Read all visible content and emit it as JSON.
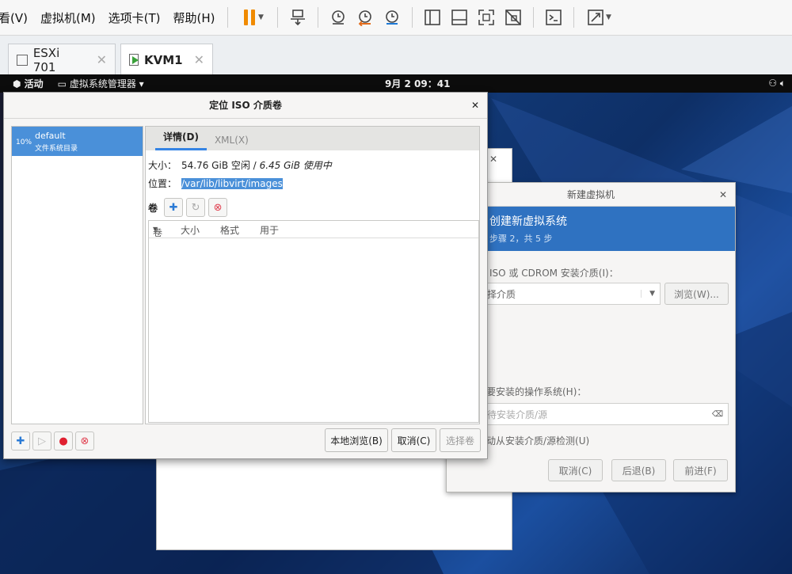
{
  "menubar": {
    "items": [
      "看(V)",
      "虚拟机(M)",
      "选项卡(T)",
      "帮助(H)"
    ]
  },
  "tabs": [
    {
      "label": "ESXi 701",
      "active": false
    },
    {
      "label": "KVM1",
      "active": true
    }
  ],
  "gnome": {
    "activities": "活动",
    "app": "虚拟系统管理器",
    "clock": "9月 2 09：41"
  },
  "new_vm": {
    "title": "新建虚拟机",
    "heading": "创建新虚拟系统",
    "step": "步骤 2，共 5 步",
    "iso_label": "ISO 或 CDROM 安装介质(I)：",
    "iso_value": "择介质",
    "browse": "浏览(W)...",
    "os_label": "要安装的操作系统(H)：",
    "os_placeholder": "待安装介质/源",
    "auto_detect": "动从安装介质/源检测(U)",
    "cancel": "取消(C)",
    "back": "后退(B)",
    "forward": "前进(F)"
  },
  "dialog": {
    "title": "定位 ISO 介质卷",
    "pool": {
      "percent": "10%",
      "name": "default",
      "type": "文件系统目录"
    },
    "tabs": [
      {
        "label": "详情(D)",
        "active": true
      },
      {
        "label": "XML(X)",
        "active": false
      }
    ],
    "size_label": "大小：",
    "size_free": "54.76 GiB 空闲 /",
    "size_used": "6.45 GiB 使用中",
    "location_label": "位置：",
    "location_value": "/var/lib/libvirt/images",
    "volumes_label": "卷",
    "columns": [
      "卷",
      "大小",
      "格式",
      "用于"
    ],
    "browse_local": "本地浏览(B)",
    "cancel": "取消(C)",
    "choose": "选择卷"
  }
}
